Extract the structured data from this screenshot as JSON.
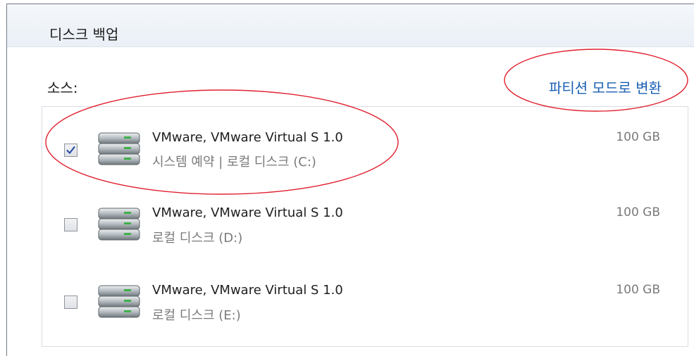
{
  "dialog": {
    "title": "디스크 백업",
    "source_label": "소스:",
    "switch_link": "파티션 모드로 변환"
  },
  "disks": [
    {
      "name": "VMware, VMware Virtual S 1.0",
      "detail": "시스템 예약 | 로컬 디스크 (C:)",
      "size": "100 GB",
      "checked": true,
      "highlighted": true
    },
    {
      "name": "VMware, VMware Virtual S 1.0",
      "detail": "로컬 디스크 (D:)",
      "size": "100 GB",
      "checked": false,
      "highlighted": false
    },
    {
      "name": "VMware, VMware Virtual S 1.0",
      "detail": "로컬 디스크 (E:)",
      "size": "100 GB",
      "checked": false,
      "highlighted": false
    }
  ],
  "colors": {
    "link": "#1a5fb4",
    "highlight_ellipse": "#e0202e",
    "checkmark": "#2a4fa8"
  },
  "icons": [
    "checkmark-icon",
    "hard-disk-icon"
  ]
}
